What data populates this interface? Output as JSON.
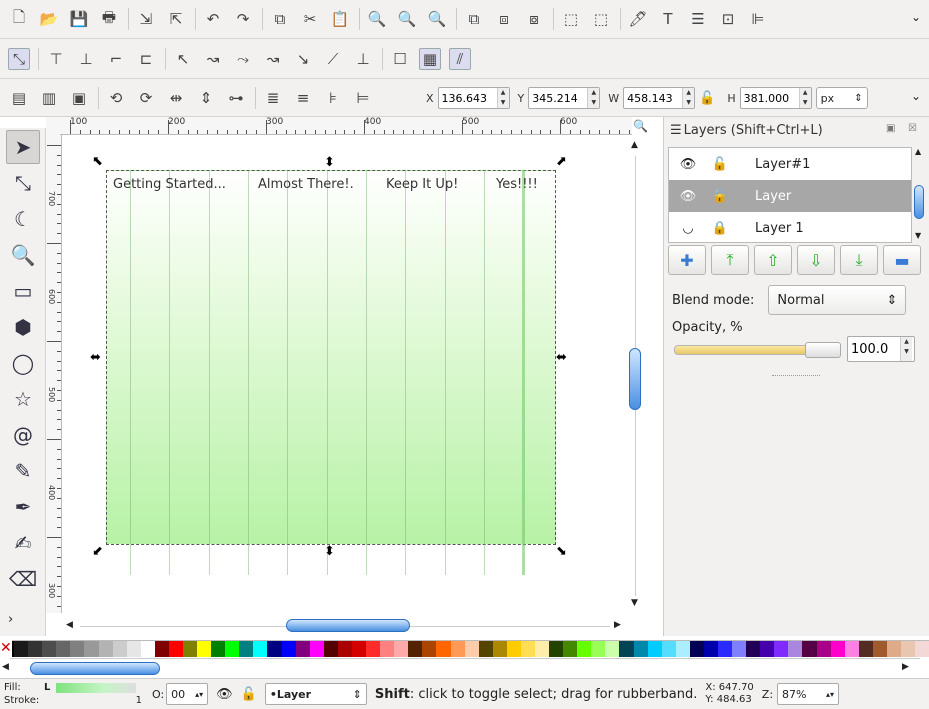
{
  "toolbars": {
    "commands_icons": [
      "new-document-icon",
      "open-icon",
      "save-icon",
      "print-icon",
      "import-icon",
      "export-icon",
      "undo-icon",
      "redo-icon",
      "copy-icon",
      "cut-icon",
      "paste-icon",
      "zoom-selection-icon",
      "zoom-drawing-icon",
      "zoom-page-icon",
      "duplicate-icon",
      "clone-icon",
      "unlink-clone-icon",
      "group-icon",
      "ungroup-icon",
      "fill-stroke-icon",
      "text-icon",
      "layers-icon",
      "xml-editor-icon",
      "align-icon"
    ],
    "commands_glyphs": [
      "🗋",
      "📂",
      "💾",
      "🖶",
      "⇲",
      "⇱",
      "↶",
      "↷",
      "⧉",
      "✂",
      "📋",
      "🔍",
      "🔍",
      "🔍",
      "⧉",
      "⧈",
      "⧇",
      "⬚",
      "⬚",
      "🖊",
      "T",
      "☰",
      "⊡",
      "⊫"
    ],
    "snap_icons": [
      "snap-enable-icon",
      "snap-bbox-icon",
      "snap-bbox-edge-icon",
      "snap-bbox-corner-icon",
      "snap-bbox-mid-icon",
      "snap-nodes-icon",
      "snap-path-icon",
      "snap-intersection-icon",
      "snap-cusp-icon",
      "snap-smooth-icon",
      "snap-midpoint-icon",
      "snap-center-icon",
      "snap-page-icon",
      "snap-grid-icon",
      "snap-guide-icon"
    ],
    "snap_glyphs": [
      "⤡",
      "⊤",
      "⊥",
      "⌐",
      "⊏",
      "↖",
      "↝",
      "⤳",
      "↝",
      "↘",
      "⟋",
      "⊥",
      "☐",
      "▦",
      "⫽"
    ],
    "align_icons": [
      "raise-top-icon",
      "raise-icon",
      "lower-icon",
      "lower-bottom-icon",
      "rotate-ccw-icon",
      "rotate-cw-icon",
      "flip-horizontal-icon",
      "flip-vertical-icon",
      "align-1-icon",
      "align-2-icon",
      "align-3-icon",
      "align-4-icon"
    ],
    "align_glyphs": [
      "▤",
      "▥",
      "▣",
      "⟲",
      "⟳",
      "⇹",
      "⇕",
      "⊶",
      "≣",
      "≡",
      "⊧",
      "⊨"
    ],
    "x_label": "X",
    "x_value": "136.643",
    "y_label": "Y",
    "y_value": "345.214",
    "w_label": "W",
    "w_value": "458.143",
    "h_label": "H",
    "h_value": "381.000",
    "unit": "px"
  },
  "tools": [
    "selector-tool-icon",
    "node-tool-icon",
    "tweak-tool-icon",
    "zoom-tool-icon",
    "rect-tool-icon",
    "box3d-tool-icon",
    "ellipse-tool-icon",
    "star-tool-icon",
    "spiral-tool-icon",
    "pencil-tool-icon",
    "pen-tool-icon",
    "calligraphy-tool-icon",
    "eraser-tool-icon"
  ],
  "tool_glyphs": [
    "➤",
    "⤡",
    "☾",
    "🔍",
    "▭",
    "⬢",
    "◯",
    "☆",
    "@",
    "✎",
    "✒",
    "✍",
    "⌫"
  ],
  "ruler": {
    "h_ticks": [
      "100",
      "200",
      "300",
      "400",
      "500",
      "600"
    ],
    "v_ticks": [
      "700",
      "600",
      "500",
      "400",
      "300"
    ]
  },
  "canvas": {
    "columns": [
      "Getting Started...",
      "Almost There!.",
      "Keep It Up!",
      "Yes!!!!"
    ]
  },
  "layers_panel": {
    "title": "Layers (Shift+Ctrl+L)",
    "layers": [
      {
        "name": "Layer#1",
        "visible": true,
        "locked": false
      },
      {
        "name": "Layer",
        "visible": true,
        "locked": false,
        "active": true
      },
      {
        "name": "Layer 1",
        "visible": false,
        "locked": true
      }
    ],
    "blend_label": "Blend mode:",
    "blend_value": "Normal",
    "opacity_label": "Opacity, %",
    "opacity_value": "100.0",
    "opacity_fraction": 1.0
  },
  "palette": [
    "#000000",
    "#1a1a1a",
    "#333333",
    "#4d4d4d",
    "#666666",
    "#808080",
    "#999999",
    "#b3b3b3",
    "#cccccc",
    "#e6e6e6",
    "#ffffff",
    "#800000",
    "#ff0000",
    "#808000",
    "#ffff00",
    "#008000",
    "#00ff00",
    "#008080",
    "#00ffff",
    "#000080",
    "#0000ff",
    "#800080",
    "#ff00ff",
    "#550000",
    "#aa0000",
    "#d40000",
    "#ff2a2a",
    "#ff8080",
    "#ffaaaa",
    "#552200",
    "#aa4400",
    "#ff6600",
    "#ff9955",
    "#ffccaa",
    "#554400",
    "#aa8800",
    "#ffcc00",
    "#ffdd55",
    "#ffeeaa",
    "#224400",
    "#448800",
    "#66ff00",
    "#99ff55",
    "#ccffaa",
    "#004455",
    "#0088aa",
    "#00ccff",
    "#55ddff",
    "#aaeeff",
    "#000055",
    "#0000aa",
    "#2a2aff",
    "#8080ff",
    "#220055",
    "#4400aa",
    "#7f2aff",
    "#aa87de",
    "#550044",
    "#aa0088",
    "#ff00cc",
    "#ff80e5",
    "#552c22",
    "#a05a2c",
    "#deaa87",
    "#e9c6af",
    "#f4d7d7"
  ],
  "status": {
    "fill_label": "Fill:",
    "stroke_label": "Stroke:",
    "fill_value": "L",
    "stroke_value": "1",
    "opacity_label": "O:",
    "opacity_value": "00",
    "layer_value": "•Layer",
    "hint_key": "Shift",
    "hint_text": ": click to toggle select; drag for rubberband.",
    "x_label": "X:",
    "x_value": "647.70",
    "y_label": "Y:",
    "y_value": "484.63",
    "zoom_label": "Z:",
    "zoom_value": "87%"
  }
}
